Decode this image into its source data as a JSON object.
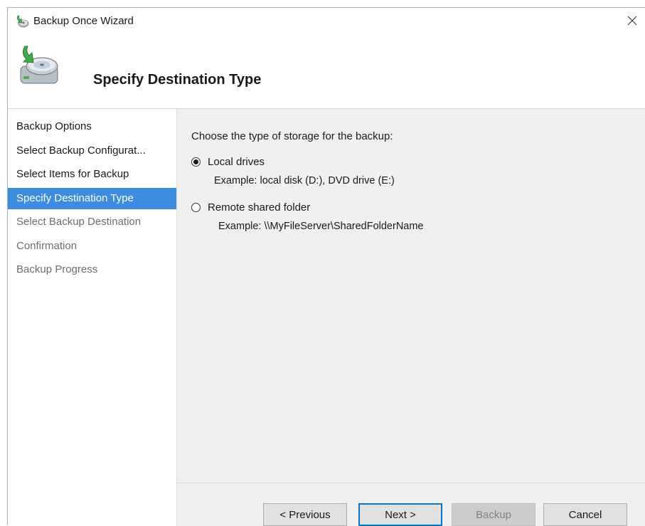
{
  "window": {
    "title": "Backup Once Wizard",
    "close_glyph": "✕"
  },
  "header": {
    "heading": "Specify Destination Type",
    "icon": "backup-disk-icon"
  },
  "sidebar": {
    "items": [
      {
        "label": "Backup Options",
        "state": "normal"
      },
      {
        "label": "Select Backup Configurat...",
        "state": "normal"
      },
      {
        "label": "Select Items for Backup",
        "state": "normal"
      },
      {
        "label": "Specify Destination Type",
        "state": "active"
      },
      {
        "label": "Select Backup Destination",
        "state": "disabled"
      },
      {
        "label": "Confirmation",
        "state": "disabled"
      },
      {
        "label": "Backup Progress",
        "state": "disabled"
      }
    ]
  },
  "main": {
    "prompt": "Choose the type of storage for the backup:",
    "options": [
      {
        "label": "Local drives",
        "example": "Example: local disk (D:), DVD drive (E:)",
        "selected": true
      },
      {
        "label": "Remote shared folder",
        "example": "Example: \\\\MyFileServer\\SharedFolderName",
        "selected": false
      }
    ]
  },
  "footer": {
    "previous_label": "< Previous",
    "next_label": "Next >",
    "backup_label": "Backup",
    "cancel_label": "Cancel"
  },
  "colors": {
    "active_item": "#3c8ddf",
    "content_bg": "#f0f0f0",
    "default_button_border": "#0078d7"
  }
}
